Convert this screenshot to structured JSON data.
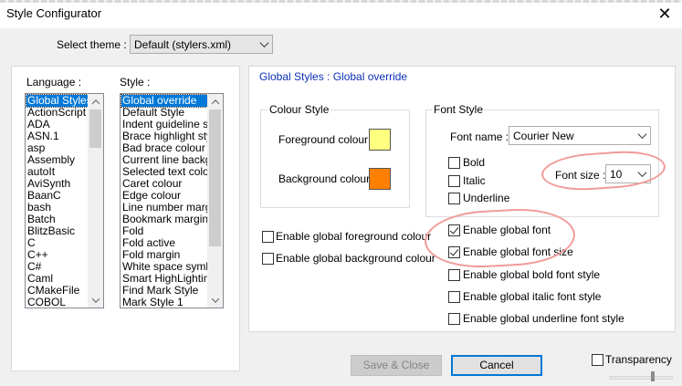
{
  "window": {
    "title": "Style Configurator",
    "close_glyph": "✕"
  },
  "theme": {
    "label": "Select theme :",
    "selected": "Default (stylers.xml)"
  },
  "language": {
    "header": "Language :",
    "items": [
      "Global Styles",
      "ActionScript",
      "ADA",
      "ASN.1",
      "asp",
      "Assembly",
      "autoIt",
      "AviSynth",
      "BaanC",
      "bash",
      "Batch",
      "BlitzBasic",
      "C",
      "C++",
      "C#",
      "Caml",
      "CMakeFile",
      "COBOL"
    ],
    "selected_index": 0
  },
  "style": {
    "header": "Style :",
    "items": [
      "Global override",
      "Default Style",
      "Indent guideline sty",
      "Brace highlight style",
      "Bad brace colour",
      "Current line backgr",
      "Selected text colou",
      "Caret colour",
      "Edge colour",
      "Line number margin",
      "Bookmark margin",
      "Fold",
      "Fold active",
      "Fold margin",
      "White space symbo",
      "Smart HighLighting",
      "Find Mark Style",
      "Mark Style 1"
    ],
    "selected_index": 0
  },
  "panel": {
    "title": "Global Styles : Global override",
    "colour_style": {
      "title": "Colour Style",
      "foreground_label": "Foreground colour",
      "foreground_color": "#ffff80",
      "background_label": "Background colour",
      "background_color": "#ff8000"
    },
    "font_style": {
      "title": "Font Style",
      "font_name_label": "Font name :",
      "font_name_value": "Courier New",
      "bold_label": "Bold",
      "italic_label": "Italic",
      "underline_label": "Underline",
      "font_size_label": "Font size :",
      "font_size_value": "10"
    },
    "global_options": [
      {
        "label": "Enable global foreground colour",
        "checked": false
      },
      {
        "label": "Enable global background colour",
        "checked": false
      },
      {
        "label": "Enable global font",
        "checked": true
      },
      {
        "label": "Enable global font size",
        "checked": true
      },
      {
        "label": "Enable global bold font style",
        "checked": false
      },
      {
        "label": "Enable global italic font style",
        "checked": false
      },
      {
        "label": "Enable global underline font style",
        "checked": false
      }
    ]
  },
  "footer": {
    "save_close_label": "Save & Close",
    "cancel_label": "Cancel",
    "transparency_label": "Transparency"
  }
}
